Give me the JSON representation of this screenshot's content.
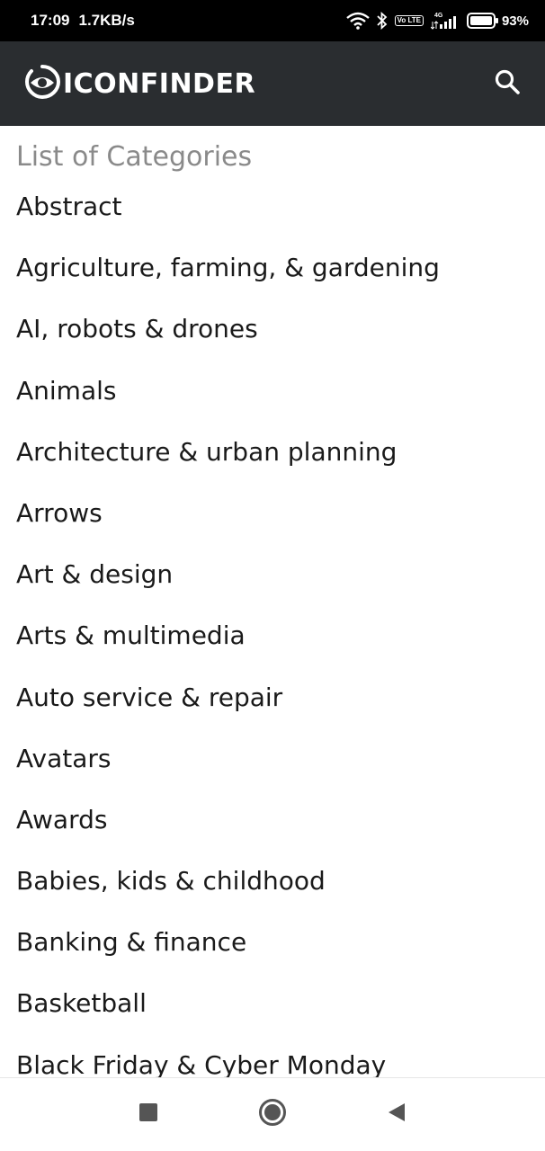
{
  "status_bar": {
    "time": "17:09",
    "speed": "1.7KB/s",
    "network": "4G",
    "volte": "Vo LTE",
    "battery": "93%",
    "icons": [
      "wifi-icon",
      "bluetooth-icon",
      "volte-icon",
      "signal-icon",
      "battery-icon"
    ]
  },
  "header": {
    "brand": "ICONFINDER",
    "logo_icon": "eye-logo-icon",
    "search_icon": "search-icon",
    "background": "#2a2d30"
  },
  "main": {
    "title": "List of Categories",
    "categories": [
      "Abstract",
      "Agriculture, farming, & gardening",
      "AI, robots & drones",
      "Animals",
      "Architecture & urban planning",
      "Arrows",
      "Art & design",
      "Arts & multimedia",
      "Auto service & repair",
      "Avatars",
      "Awards",
      "Babies, kids & childhood",
      "Banking & finance",
      "Basketball",
      "Black Friday & Cyber Monday"
    ]
  },
  "nav_bar": {
    "buttons": [
      "recents-square-icon",
      "home-circle-icon",
      "back-triangle-icon"
    ]
  }
}
